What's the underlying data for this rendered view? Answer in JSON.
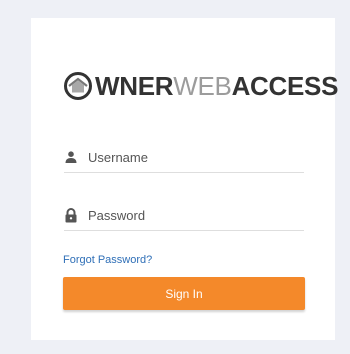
{
  "logo": {
    "prefix": "WNER",
    "middle": "WEB",
    "suffix": "ACCESS",
    "icon": "house-circle-icon"
  },
  "form": {
    "username_placeholder": "Username",
    "password_placeholder": "Password",
    "username_icon": "user-icon",
    "password_icon": "lock-icon",
    "forgot_label": "Forgot Password?",
    "signin_label": "Sign In"
  },
  "colors": {
    "accent": "#f4892a",
    "link": "#2f6fb7",
    "background": "#eef0f6"
  }
}
